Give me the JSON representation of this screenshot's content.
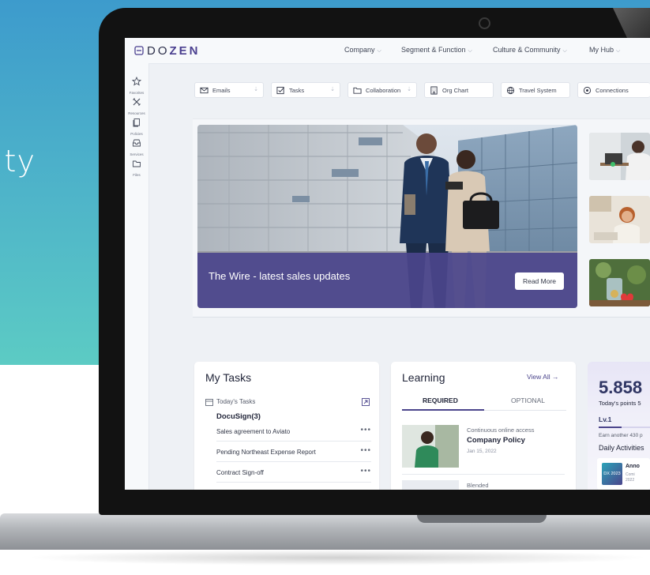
{
  "background": {
    "text": "ity",
    "colors": {
      "top": "#3d9bcc",
      "bottom": "#5ccbc4"
    }
  },
  "app": {
    "logo_prefix": "DO",
    "logo_accent": "ZEN",
    "accent_color": "#4b458c",
    "nav": [
      {
        "label": "Company"
      },
      {
        "label": "Segment & Function"
      },
      {
        "label": "Culture & Community"
      },
      {
        "label": "My Hub"
      }
    ]
  },
  "sidebar": {
    "items": [
      {
        "label": "Favorites",
        "icon": "star-icon"
      },
      {
        "label": "Resources",
        "icon": "tools-icon"
      },
      {
        "label": "Policies",
        "icon": "documents-icon"
      },
      {
        "label": "Services",
        "icon": "tray-icon"
      },
      {
        "label": "Files",
        "icon": "folder-icon"
      }
    ]
  },
  "quick_links": [
    {
      "label": "Emails",
      "icon": "mail-icon"
    },
    {
      "label": "Tasks",
      "icon": "checkbox-icon"
    },
    {
      "label": "Collaboration",
      "icon": "folder-icon"
    },
    {
      "label": "Org Chart",
      "icon": "building-icon"
    },
    {
      "label": "Travel System",
      "icon": "globe-icon"
    },
    {
      "label": "Connections",
      "icon": "connections-icon"
    }
  ],
  "hero": {
    "title": "The Wire - latest sales updates",
    "button": "Read More"
  },
  "tasks": {
    "title": "My Tasks",
    "today": "Today's Tasks",
    "group": "DocuSign(3)",
    "items": [
      {
        "label": "Sales agreement to Aviato"
      },
      {
        "label": "Pending Northeast Expense Report"
      },
      {
        "label": "Contract Sign-off"
      }
    ],
    "more": "•••"
  },
  "learning": {
    "title": "Learning",
    "view_all": "View All →",
    "tabs": [
      "REQUIRED",
      "OPTIONAL"
    ],
    "course": {
      "kind": "Continuous online access",
      "name": "Company Policy",
      "date": "Jan 15, 2022"
    },
    "next_kind": "Blended"
  },
  "points": {
    "value": "5.858",
    "today_label": "Today's points 5",
    "level": "Lv.1",
    "earn_text": "Earn another 430 p",
    "daily": "Daily Activities",
    "badge": "DX 2023",
    "activity_title": "Anno",
    "activity_sub1": "Comi",
    "activity_sub2": "2022"
  }
}
